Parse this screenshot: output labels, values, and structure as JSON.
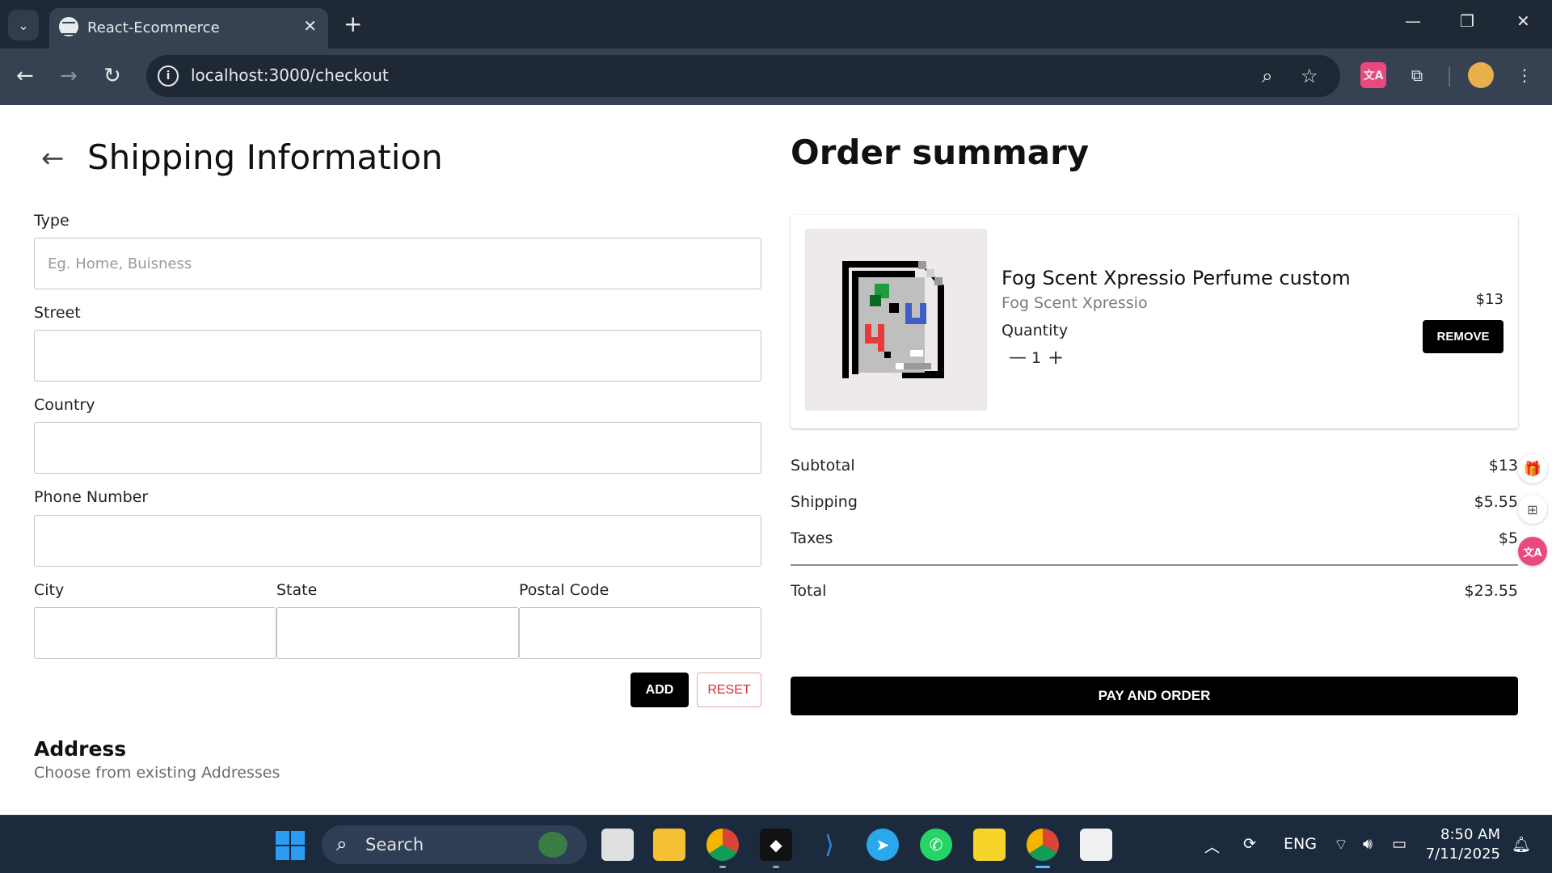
{
  "browser": {
    "tab_title": "React-Ecommerce",
    "url": "localhost:3000/checkout"
  },
  "shipping": {
    "title": "Shipping Information",
    "fields": {
      "type": {
        "label": "Type",
        "placeholder": "Eg. Home, Buisness",
        "value": ""
      },
      "street": {
        "label": "Street",
        "value": ""
      },
      "country": {
        "label": "Country",
        "value": ""
      },
      "phone": {
        "label": "Phone Number",
        "value": ""
      },
      "city": {
        "label": "City",
        "value": ""
      },
      "state": {
        "label": "State",
        "value": ""
      },
      "postal": {
        "label": "Postal Code",
        "value": ""
      }
    },
    "add_label": "ADD",
    "reset_label": "RESET"
  },
  "address": {
    "title": "Address",
    "subtitle": "Choose from existing Addresses"
  },
  "order": {
    "title": "Order summary",
    "item": {
      "name": "Fog Scent Xpressio Perfume custom",
      "brand": "Fog Scent Xpressio",
      "quantity_label": "Quantity",
      "quantity": "1",
      "price": "$13",
      "remove_label": "REMOVE"
    },
    "subtotal_label": "Subtotal",
    "subtotal": "$13",
    "shipping_label": "Shipping",
    "shipping": "$5.55",
    "taxes_label": "Taxes",
    "taxes": "$5",
    "total_label": "Total",
    "total": "$23.55",
    "pay_label": "PAY AND ORDER"
  },
  "taskbar": {
    "search_label": "Search",
    "language": "ENG",
    "time": "8:50 AM",
    "date": "7/11/2025"
  },
  "colors": {
    "accent": "#000000",
    "reset": "#d32f2f",
    "chrome_dark": "#1f2936",
    "chrome_bar": "#364152",
    "taskbar": "#1c2a3d"
  }
}
